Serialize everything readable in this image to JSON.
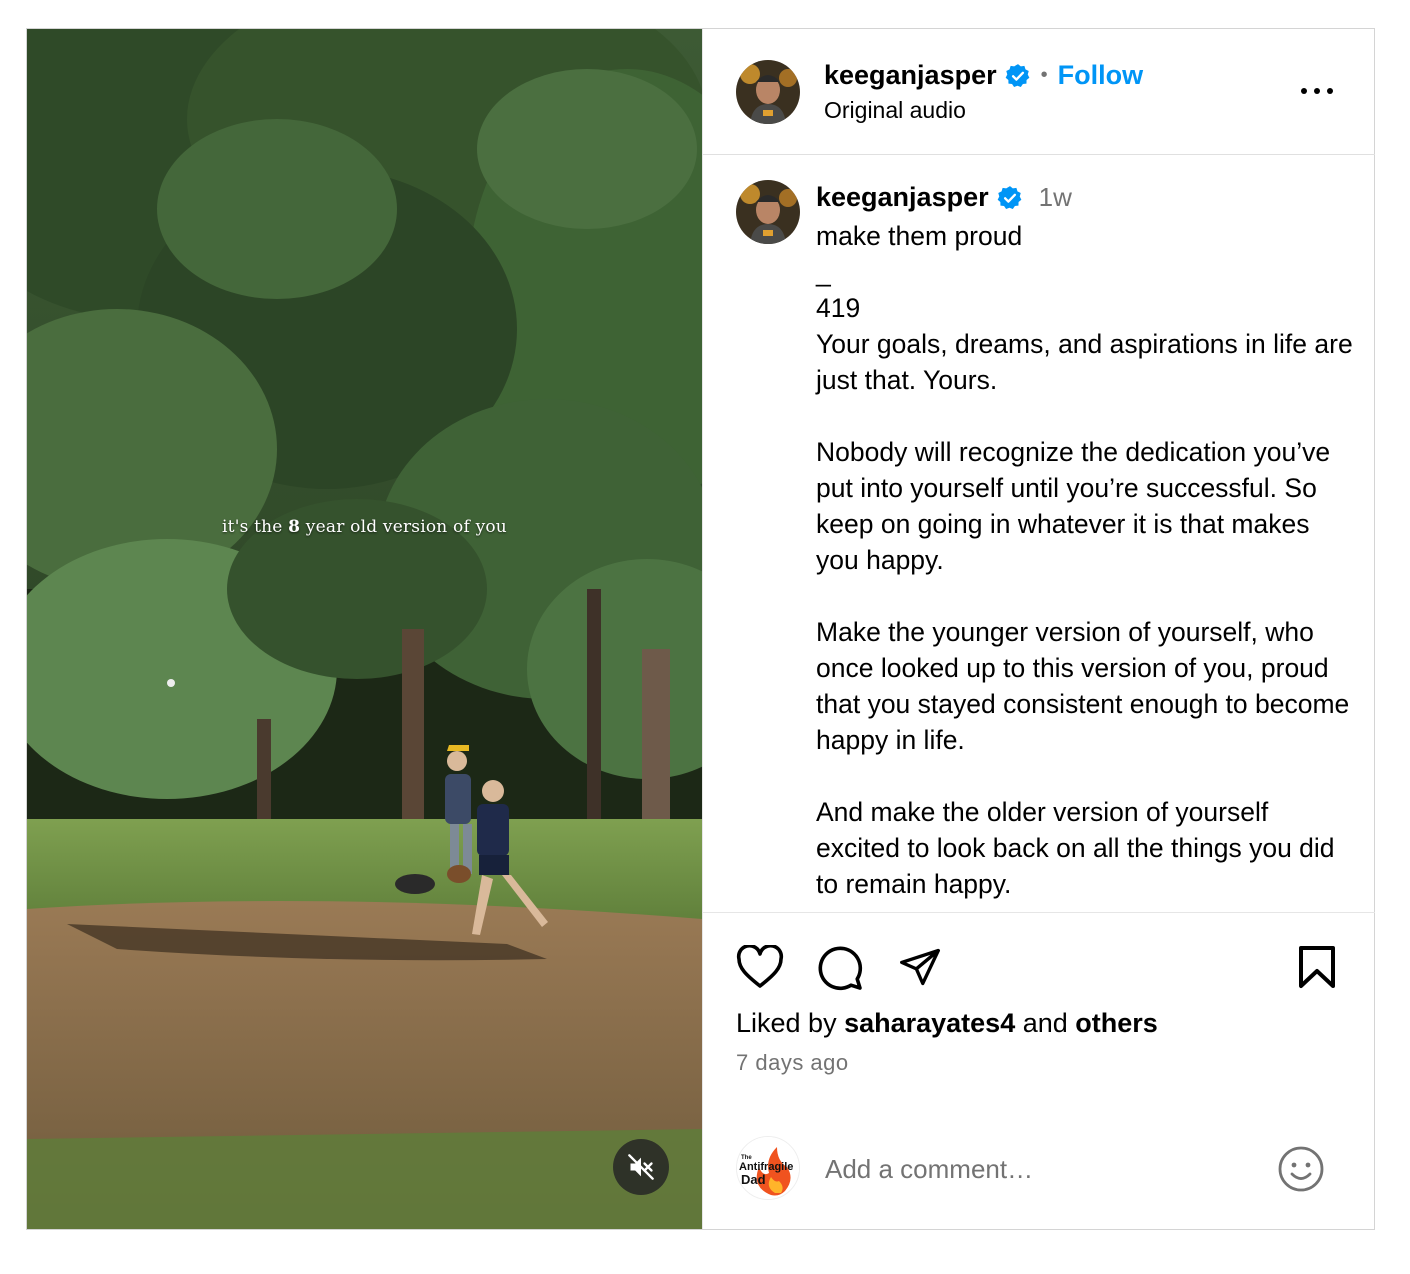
{
  "media": {
    "overlay_pre": "it's the ",
    "overlay_bold": "8",
    "overlay_post": " year old version of you",
    "mute_icon": "speaker-muted-icon"
  },
  "header": {
    "username": "keeganjasper",
    "separator": "•",
    "follow_label": "Follow",
    "audio_label": "Original audio",
    "more_icon": "more-horizontal-icon"
  },
  "caption": {
    "username": "keeganjasper",
    "time": "1w",
    "text": "make them proud\n_\n419\nYour goals, dreams, and aspirations in life are just that. Yours.\n\nNobody will recognize the dedication you’ve put into yourself until you’re successful. So keep on going in whatever it is that makes you happy.\n\nMake the younger version of yourself, who once looked up to this version of you, proud that you stayed consistent enough to become happy in life.\n\nAnd make the older version of yourself excited to look back on all the things you did to remain happy."
  },
  "actions": {
    "icons": [
      "heart-icon",
      "comment-icon",
      "share-icon",
      "bookmark-icon"
    ],
    "liked_prefix": "Liked by ",
    "liked_user": "saharayates4",
    "liked_mid": " and ",
    "liked_others": "others",
    "posted_ago": "7 days ago"
  },
  "comment": {
    "avatar_text_1": "The",
    "avatar_text_2": "Antifragile",
    "avatar_text_3": "Dad",
    "placeholder": "Add a comment…",
    "emoji_icon": "smiley-icon"
  },
  "colors": {
    "follow_blue": "#0095f6",
    "verified_blue": "#0095f6",
    "secondary_text": "#737373"
  }
}
